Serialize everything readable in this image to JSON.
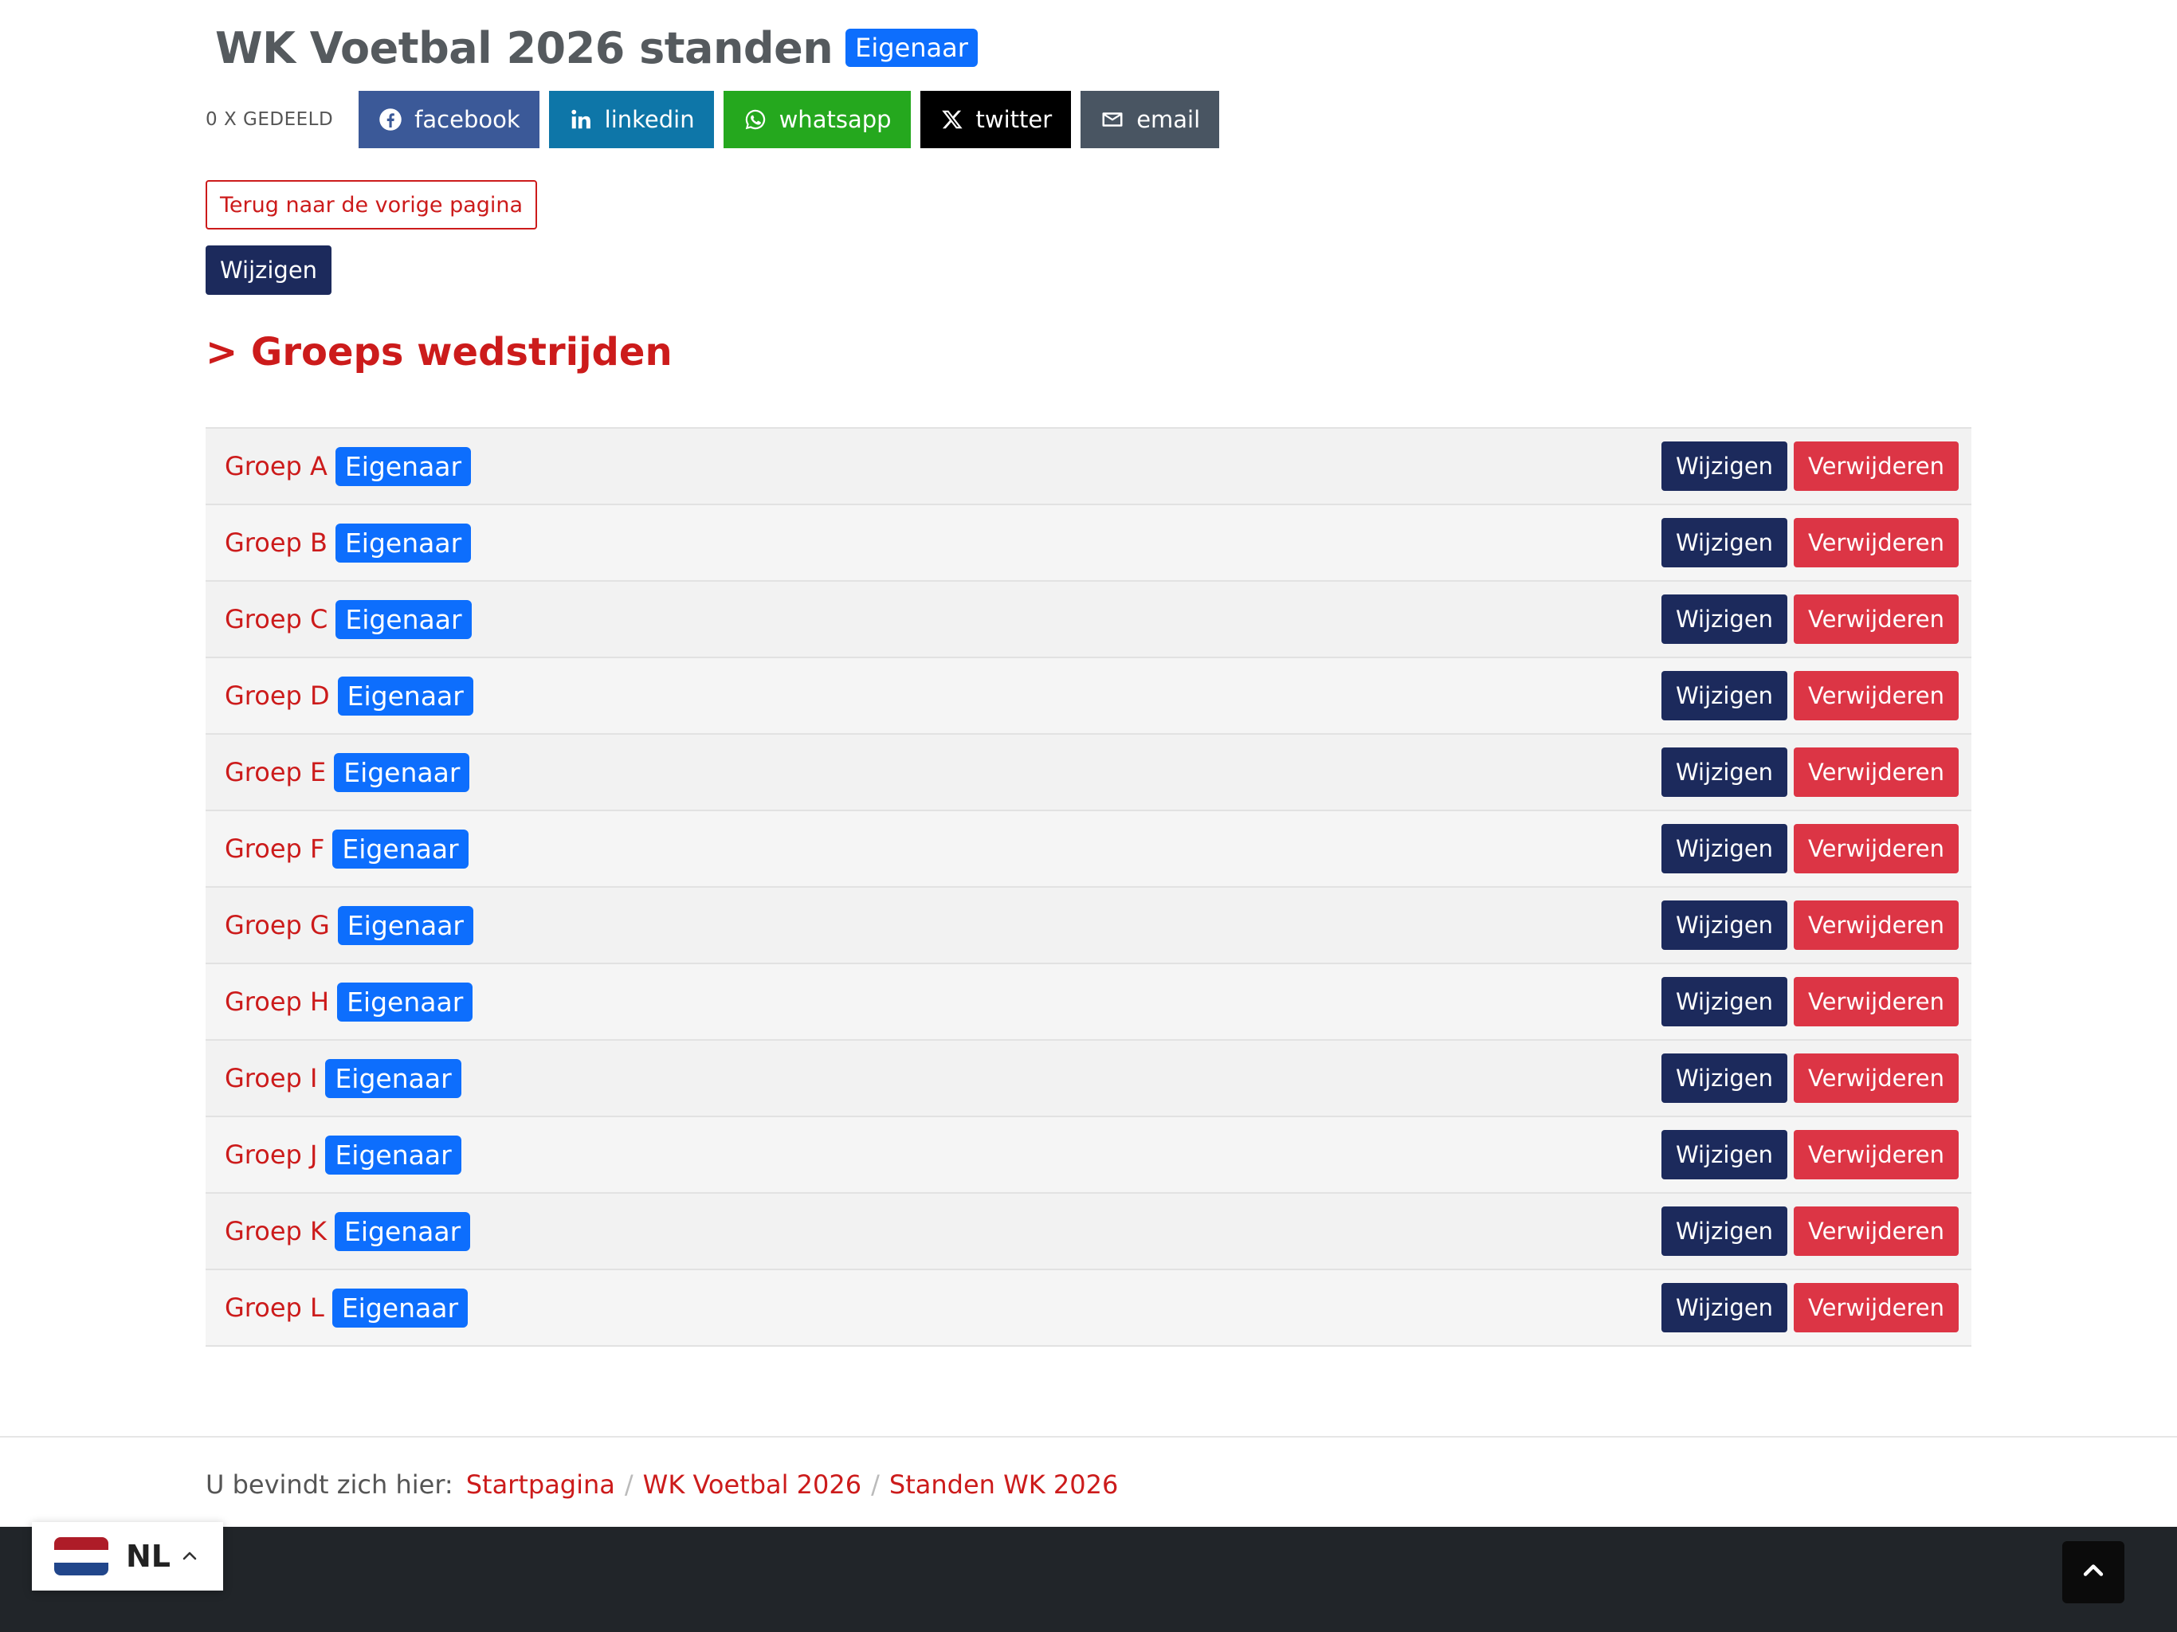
{
  "header": {
    "title": "WK Voetbal 2026 standen",
    "badge": "Eigenaar"
  },
  "share": {
    "count_label": "0 X GEDEELD",
    "buttons": [
      {
        "label": "facebook",
        "icon": "facebook-icon",
        "color": "#3b5998"
      },
      {
        "label": "linkedin",
        "icon": "linkedin-icon",
        "color": "#0e76a8"
      },
      {
        "label": "whatsapp",
        "icon": "whatsapp-icon",
        "color": "#25a81e"
      },
      {
        "label": "twitter",
        "icon": "x-twitter-icon",
        "color": "#000000"
      },
      {
        "label": "email",
        "icon": "email-icon",
        "color": "#495562"
      }
    ]
  },
  "actions": {
    "back_label": "Terug naar de vorige pagina",
    "edit_label": "Wijzigen"
  },
  "section": {
    "title": "> Groeps wedstrijden"
  },
  "groups": [
    {
      "name": "Groep A",
      "badge": "Eigenaar",
      "edit": "Wijzigen",
      "delete": "Verwijderen"
    },
    {
      "name": "Groep B",
      "badge": "Eigenaar",
      "edit": "Wijzigen",
      "delete": "Verwijderen"
    },
    {
      "name": "Groep C",
      "badge": "Eigenaar",
      "edit": "Wijzigen",
      "delete": "Verwijderen"
    },
    {
      "name": "Groep D",
      "badge": "Eigenaar",
      "edit": "Wijzigen",
      "delete": "Verwijderen"
    },
    {
      "name": "Groep E",
      "badge": "Eigenaar",
      "edit": "Wijzigen",
      "delete": "Verwijderen"
    },
    {
      "name": "Groep F",
      "badge": "Eigenaar",
      "edit": "Wijzigen",
      "delete": "Verwijderen"
    },
    {
      "name": "Groep G",
      "badge": "Eigenaar",
      "edit": "Wijzigen",
      "delete": "Verwijderen"
    },
    {
      "name": "Groep H",
      "badge": "Eigenaar",
      "edit": "Wijzigen",
      "delete": "Verwijderen"
    },
    {
      "name": "Groep I",
      "badge": "Eigenaar",
      "edit": "Wijzigen",
      "delete": "Verwijderen"
    },
    {
      "name": "Groep J",
      "badge": "Eigenaar",
      "edit": "Wijzigen",
      "delete": "Verwijderen"
    },
    {
      "name": "Groep K",
      "badge": "Eigenaar",
      "edit": "Wijzigen",
      "delete": "Verwijderen"
    },
    {
      "name": "Groep L",
      "badge": "Eigenaar",
      "edit": "Wijzigen",
      "delete": "Verwijderen"
    }
  ],
  "breadcrumb": {
    "prefix": "U bevindt zich hier:",
    "items": [
      "Startpagina",
      "WK Voetbal 2026",
      "Standen WK 2026"
    ],
    "separator": "/"
  },
  "language": {
    "code": "NL",
    "flag_icon": "netherlands-flag-icon",
    "chevron_icon": "chevron-up-icon"
  },
  "back_to_top": {
    "icon": "chevron-up-icon"
  },
  "colors": {
    "accent_red": "#cc1b1b",
    "navy": "#1c2a5c",
    "danger": "#dc3545",
    "badge_blue": "#0d6efd",
    "footer_dark": "#212529"
  }
}
